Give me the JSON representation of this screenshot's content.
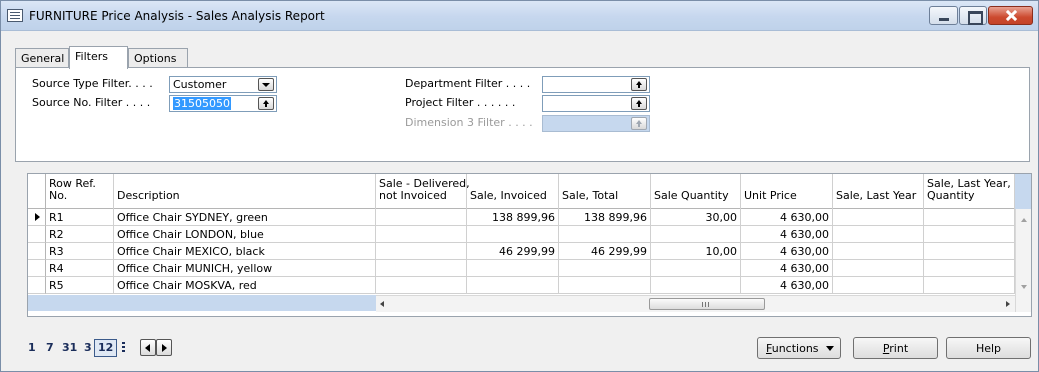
{
  "window": {
    "title": "FURNITURE Price Analysis - Sales Analysis Report"
  },
  "tabs": [
    {
      "label": "General"
    },
    {
      "label": "Filters"
    },
    {
      "label": "Options"
    }
  ],
  "filters": {
    "source_type": {
      "label": "Source Type Filter. . . .",
      "value": "Customer"
    },
    "source_no": {
      "label": "Source No. Filter . . . .",
      "value": "31505050"
    },
    "department": {
      "label": "Department Filter . . . .",
      "value": ""
    },
    "project": {
      "label": "Project Filter . . . . . .",
      "value": ""
    },
    "dimension3": {
      "label": "Dimension 3 Filter . . . .",
      "value": ""
    }
  },
  "grid": {
    "columns": [
      {
        "line1": "Row Ref.",
        "line2": "No."
      },
      {
        "line1": "",
        "line2": "Description"
      },
      {
        "line1": "Sale - Delivered,",
        "line2": "not Invoiced"
      },
      {
        "line1": "",
        "line2": "Sale, Invoiced"
      },
      {
        "line1": "",
        "line2": "Sale, Total"
      },
      {
        "line1": "",
        "line2": "Sale Quantity"
      },
      {
        "line1": "",
        "line2": "Unit Price"
      },
      {
        "line1": "",
        "line2": "Sale, Last Year"
      },
      {
        "line1": "Sale, Last Year,",
        "line2": "Quantity"
      }
    ],
    "rows": [
      {
        "ref": "R1",
        "desc": "Office Chair SYDNEY, green",
        "delivered": "",
        "invoiced": "138 899,96",
        "total": "138 899,96",
        "qty": "30,00",
        "unit_price": "4 630,00",
        "last_year": "",
        "last_year_qty": ""
      },
      {
        "ref": "R2",
        "desc": "Office Chair LONDON, blue",
        "delivered": "",
        "invoiced": "",
        "total": "",
        "qty": "",
        "unit_price": "4 630,00",
        "last_year": "",
        "last_year_qty": ""
      },
      {
        "ref": "R3",
        "desc": "Office Chair MEXICO, black",
        "delivered": "",
        "invoiced": "46 299,99",
        "total": "46 299,99",
        "qty": "10,00",
        "unit_price": "4 630,00",
        "last_year": "",
        "last_year_qty": ""
      },
      {
        "ref": "R4",
        "desc": "Office Chair MUNICH, yellow",
        "delivered": "",
        "invoiced": "",
        "total": "",
        "qty": "",
        "unit_price": "4 630,00",
        "last_year": "",
        "last_year_qty": ""
      },
      {
        "ref": "R5",
        "desc": "Office Chair MOSKVA, red",
        "delivered": "",
        "invoiced": "",
        "total": "",
        "qty": "",
        "unit_price": "4 630,00",
        "last_year": "",
        "last_year_qty": ""
      }
    ]
  },
  "pager": {
    "items": [
      "1",
      "7",
      "31",
      "3",
      "12"
    ],
    "selected": "12"
  },
  "buttons": {
    "functions": {
      "accel": "F",
      "rest": "unctions"
    },
    "print": {
      "accel": "P",
      "rest": "rint"
    },
    "help": {
      "label": "Help"
    }
  },
  "colors": {
    "selection": "#3399ff",
    "disabled_field": "#c6d8ee",
    "title_bar": "#c6d7ee",
    "close_button": "#cc4a2f"
  }
}
